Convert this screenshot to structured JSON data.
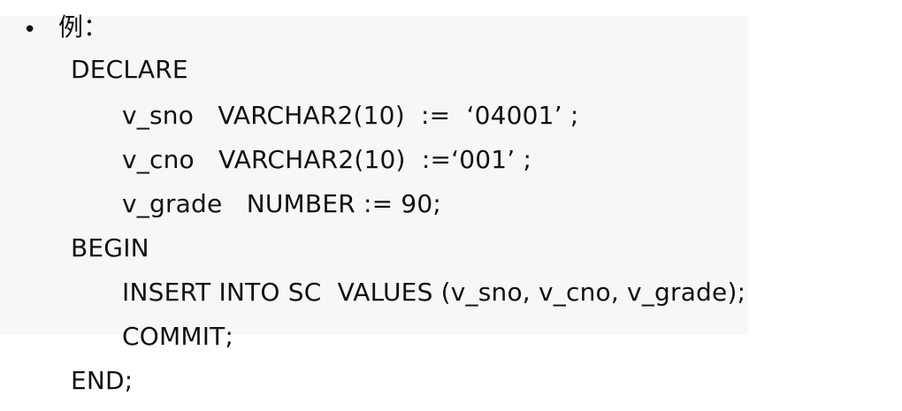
{
  "slide": {
    "bullet": "•",
    "label": "例：",
    "code_lines": [
      "DECLARE",
      "v_sno   VARCHAR2(10)  :=  ‘04001’ ;",
      "v_cno   VARCHAR2(10)  :=‘001’ ;",
      "v_grade   NUMBER := 90;",
      "BEGIN",
      "INSERT INTO SC  VALUES (v_sno, v_cno, v_grade);",
      "COMMIT;",
      "END;"
    ]
  }
}
